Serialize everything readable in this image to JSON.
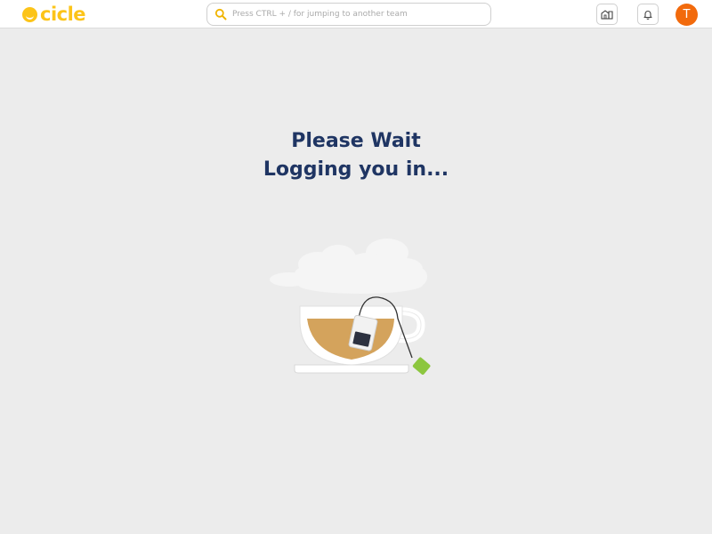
{
  "app": {
    "logo_text": "cicle"
  },
  "search": {
    "placeholder": "Press CTRL + / for jumping to another team"
  },
  "header": {
    "avatar_initial": "T"
  },
  "main": {
    "line1": "Please Wait",
    "line2": "Logging you in..."
  },
  "icons": {
    "logo": "cicle-logo-icon",
    "search": "search-icon",
    "company": "buildings-icon",
    "notifications": "bell-icon",
    "illustration": "tea-cup-illustration"
  },
  "colors": {
    "brand": "#fcc419",
    "heading": "#1f3563",
    "avatar": "#f26a0c",
    "background": "#ececec",
    "tea": "#d4a35c",
    "tea_tag": "#8cc63f"
  }
}
